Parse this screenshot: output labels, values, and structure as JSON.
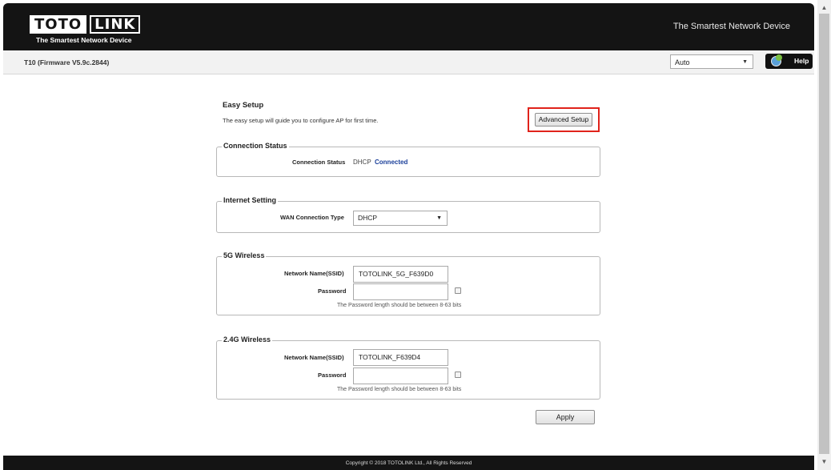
{
  "header": {
    "logo_left": "TOTO",
    "logo_right": "LINK",
    "logo_tagline": "The Smartest Network Device",
    "tagline": "The Smartest Network Device"
  },
  "subbar": {
    "firmware": "T10 (Firmware V5.9c.2844)",
    "language": "Auto",
    "help_label": "Help"
  },
  "easy_setup": {
    "title": "Easy Setup",
    "description": "The easy setup will guide you to configure AP for first time.",
    "advanced_button": "Advanced Setup"
  },
  "connection_status": {
    "legend": "Connection Status",
    "label": "Connection Status",
    "type": "DHCP",
    "state": "Connected"
  },
  "internet_setting": {
    "legend": "Internet Setting",
    "wan_label": "WAN Connection Type",
    "wan_value": "DHCP"
  },
  "wireless_5g": {
    "legend": "5G Wireless",
    "ssid_label": "Network Name(SSID)",
    "ssid_value": "TOTOLINK_5G_F639D0",
    "password_label": "Password",
    "password_value": "",
    "hint": "The Password length should be between 8-63 bits"
  },
  "wireless_24g": {
    "legend": "2.4G Wireless",
    "ssid_label": "Network Name(SSID)",
    "ssid_value": "TOTOLINK_F639D4",
    "password_label": "Password",
    "password_value": "",
    "hint": "The Password length should be between 8-63 bits"
  },
  "apply_label": "Apply",
  "footer": "Copyright © 2018 TOTOLINK Ltd.,   All Rights Reserved",
  "colors": {
    "header_bg": "#141414",
    "highlight_border": "#e0231b",
    "status_blue": "#1a3f9a"
  }
}
